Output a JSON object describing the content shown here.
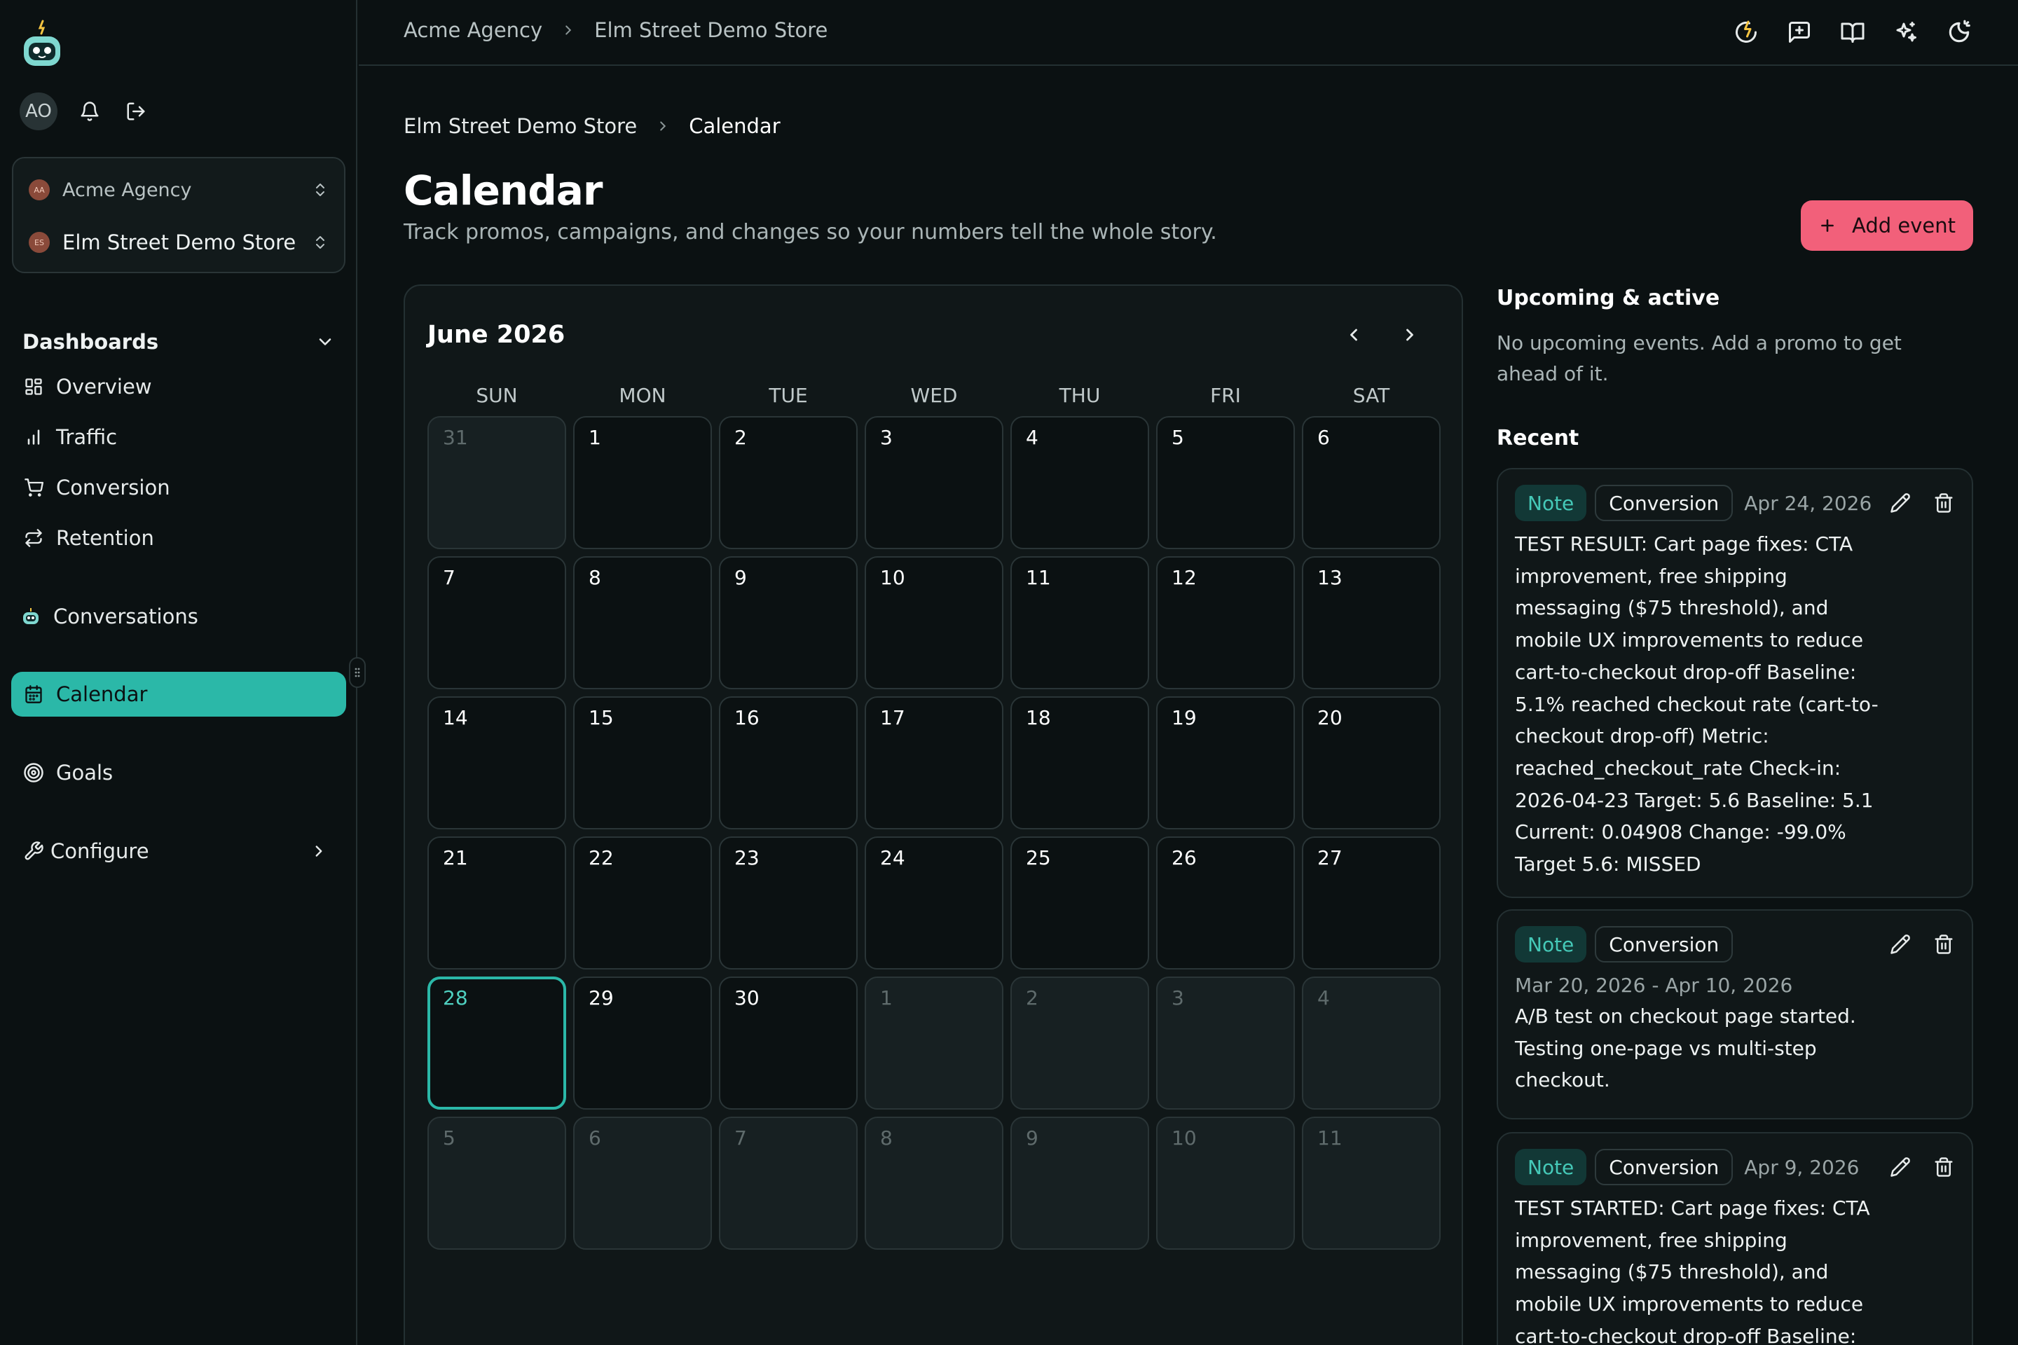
{
  "sidebar": {
    "avatar_initials": "AO",
    "workspace": {
      "badge": "AA",
      "label": "Acme Agency"
    },
    "store": {
      "badge": "ES",
      "label": "Elm Street Demo Store"
    },
    "dashboards_label": "Dashboards",
    "items": [
      {
        "label": "Overview",
        "icon": "grid-icon"
      },
      {
        "label": "Traffic",
        "icon": "bar-chart-icon"
      },
      {
        "label": "Conversion",
        "icon": "cart-icon"
      },
      {
        "label": "Retention",
        "icon": "repeat-icon"
      }
    ],
    "conversations_label": "Conversations",
    "calendar_label": "Calendar",
    "goals_label": "Goals",
    "configure_label": "Configure",
    "accent": "#2bb8a8"
  },
  "topbar": {
    "breadcrumb": [
      "Acme Agency",
      "Elm Street Demo Store"
    ],
    "icons": [
      "whats-new-icon",
      "feedback-icon",
      "docs-icon",
      "ai-sparkle-icon",
      "theme-toggle-icon"
    ]
  },
  "page": {
    "breadcrumb": [
      "Elm Street Demo Store",
      "Calendar"
    ],
    "title": "Calendar",
    "subtitle": "Track promos, campaigns, and changes so your numbers tell the whole story.",
    "add_button": "Add event",
    "add_button_color": "#f2607a"
  },
  "calendar": {
    "month_label": "June 2026",
    "weekdays": [
      "SUN",
      "MON",
      "TUE",
      "WED",
      "THU",
      "FRI",
      "SAT"
    ],
    "weeks": [
      [
        "31",
        "1",
        "2",
        "3",
        "4",
        "5",
        "6"
      ],
      [
        "7",
        "8",
        "9",
        "10",
        "11",
        "12",
        "13"
      ],
      [
        "14",
        "15",
        "16",
        "17",
        "18",
        "19",
        "20"
      ],
      [
        "21",
        "22",
        "23",
        "24",
        "25",
        "26",
        "27"
      ],
      [
        "28",
        "29",
        "30",
        "1",
        "2",
        "3",
        "4"
      ],
      [
        "5",
        "6",
        "7",
        "8",
        "9",
        "10",
        "11"
      ]
    ],
    "today": "28"
  },
  "panel": {
    "upcoming_heading": "Upcoming & active",
    "upcoming_empty": "No upcoming events. Add a promo to get ahead of it.",
    "recent_heading": "Recent",
    "events": [
      {
        "type": "Note",
        "category": "Conversion",
        "date": "Apr 24, 2026",
        "body": "TEST RESULT: Cart page fixes: CTA improvement, free shipping messaging ($75 threshold), and mobile UX improvements to reduce cart-to-checkout drop-off Baseline: 5.1% reached checkout rate (cart-to-checkout drop-off) Metric: reached_checkout_rate Check-in: 2026-04-23 Target: 5.6 Baseline: 5.1 Current: 0.04908 Change: -99.0% Target 5.6: MISSED"
      },
      {
        "type": "Note",
        "category": "Conversion",
        "date_range": "Mar 20, 2026 - Apr 10, 2026",
        "body": "A/B test on checkout page started. Testing one-page vs multi-step checkout."
      },
      {
        "type": "Note",
        "category": "Conversion",
        "date": "Apr 9, 2026",
        "body": "TEST STARTED: Cart page fixes: CTA improvement, free shipping messaging ($75 threshold), and mobile UX improvements to reduce cart-to-checkout drop-off Baseline:"
      }
    ]
  }
}
